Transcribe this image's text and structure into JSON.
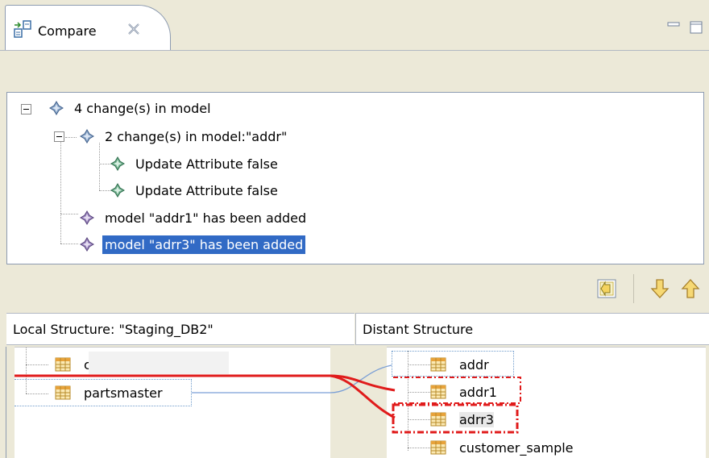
{
  "tab": {
    "title": "Compare",
    "icon": "compare-icon",
    "close_icon": "close-icon"
  },
  "window_controls": {
    "minimize_icon": "minimize-icon",
    "maximize_icon": "maximize-icon"
  },
  "tree": {
    "root": {
      "label": "4 change(s) in model",
      "icon": "change-diamond-icon",
      "expanded": true
    },
    "group": {
      "label": "2 change(s) in model:\"addr\"",
      "icon": "change-diamond-icon",
      "expanded": true
    },
    "leaf1": {
      "label": "Update Attribute false",
      "icon": "green-diamond-icon"
    },
    "leaf2": {
      "label": "Update Attribute false",
      "icon": "green-diamond-icon"
    },
    "added1": {
      "label": "model \"addr1\" has been added",
      "icon": "purple-diamond-icon"
    },
    "added2": {
      "label": "model \"adrr3\" has been added",
      "icon": "purple-diamond-icon",
      "selected": true
    }
  },
  "nav": {
    "copy_icon": "copy-left-icon",
    "next_icon": "arrow-down-icon",
    "prev_icon": "arrow-up-icon"
  },
  "local": {
    "header": "Local Structure: \"Staging_DB2\"",
    "items": [
      "customer_sample",
      "partsmaster"
    ]
  },
  "distant": {
    "header": "Distant Structure",
    "items": [
      "addr",
      "addr1",
      "adrr3",
      "customer_sample"
    ]
  },
  "colors": {
    "selection": "#316ac5",
    "highlight_red": "#e01b1b",
    "link_blue": "#7a9fd6"
  }
}
